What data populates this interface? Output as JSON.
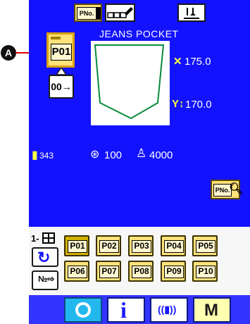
{
  "header": {
    "pattern_no_button": "PNo.",
    "pattern_name": "JEANS POCKET"
  },
  "pattern": {
    "selected_label": "P01",
    "sub_pattern_label": "00→",
    "x_scale": "175.0",
    "y_scale": "170.0"
  },
  "status": {
    "thread_count": "343",
    "speed": "100",
    "counter": "4000"
  },
  "marker": {
    "label": "A"
  },
  "registration": {
    "page_label": "1-",
    "items": [
      "P01",
      "P02",
      "P03",
      "P04",
      "P05",
      "P06",
      "P07",
      "P08",
      "P09",
      "P10"
    ],
    "selected": "P01"
  },
  "pattern_no_search_button": "PNo.",
  "colors": {
    "panel_blue": "#1212ff",
    "button_yellow": "#ffe27a",
    "mode_bar": "#3434ff"
  },
  "bottom_bar": [
    {
      "name": "ready-key",
      "icon": "ready-ring-icon"
    },
    {
      "name": "information-key",
      "icon": "info-icon"
    },
    {
      "name": "communication-key",
      "icon": "communication-icon"
    },
    {
      "name": "mode-key",
      "label": "M"
    }
  ]
}
